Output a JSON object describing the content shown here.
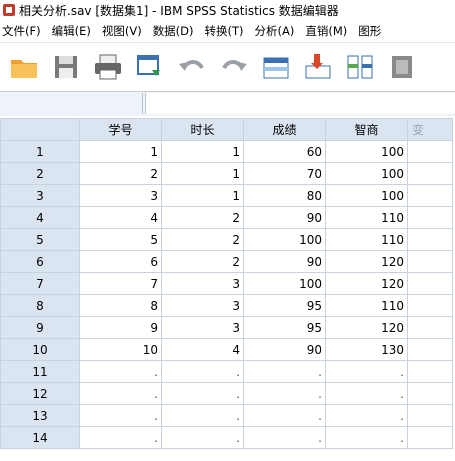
{
  "window": {
    "title": "相关分析.sav [数据集1] - IBM SPSS Statistics 数据编辑器"
  },
  "menu": [
    {
      "label": "文件(F)"
    },
    {
      "label": "编辑(E)"
    },
    {
      "label": "视图(V)"
    },
    {
      "label": "数据(D)"
    },
    {
      "label": "转换(T)"
    },
    {
      "label": "分析(A)"
    },
    {
      "label": "直销(M)"
    },
    {
      "label": "图形"
    }
  ],
  "toolbar": [
    {
      "icon": "open-folder-icon",
      "color": "#f0a030"
    },
    {
      "icon": "save-icon",
      "color": "#7a7a7a"
    },
    {
      "icon": "print-icon",
      "color": "#666666"
    },
    {
      "icon": "recall-dialog-icon",
      "color": "#3a6fb0"
    },
    {
      "icon": "undo-icon",
      "color": "#9aa0a6"
    },
    {
      "icon": "redo-icon",
      "color": "#9aa0a6"
    },
    {
      "icon": "goto-case-icon",
      "color": "#3a6fb0"
    },
    {
      "icon": "goto-variable-icon",
      "color": "#d9482b"
    },
    {
      "icon": "variables-icon",
      "color": "#3a6fb0"
    },
    {
      "icon": "find-icon",
      "color": "#8a8a8a"
    }
  ],
  "grid": {
    "columns": [
      "学号",
      "时长",
      "成绩",
      "智商",
      "变"
    ],
    "rows": [
      {
        "n": "1",
        "cells": [
          "1",
          "1",
          "60",
          "100"
        ]
      },
      {
        "n": "2",
        "cells": [
          "2",
          "1",
          "70",
          "100"
        ]
      },
      {
        "n": "3",
        "cells": [
          "3",
          "1",
          "80",
          "100"
        ]
      },
      {
        "n": "4",
        "cells": [
          "4",
          "2",
          "90",
          "110"
        ]
      },
      {
        "n": "5",
        "cells": [
          "5",
          "2",
          "100",
          "110"
        ]
      },
      {
        "n": "6",
        "cells": [
          "6",
          "2",
          "90",
          "120"
        ]
      },
      {
        "n": "7",
        "cells": [
          "7",
          "3",
          "100",
          "120"
        ]
      },
      {
        "n": "8",
        "cells": [
          "8",
          "3",
          "95",
          "110"
        ]
      },
      {
        "n": "9",
        "cells": [
          "9",
          "3",
          "95",
          "120"
        ]
      },
      {
        "n": "10",
        "cells": [
          "10",
          "4",
          "90",
          "130"
        ]
      },
      {
        "n": "11",
        "cells": [
          ".",
          ".",
          ".",
          "."
        ]
      },
      {
        "n": "12",
        "cells": [
          ".",
          ".",
          ".",
          "."
        ]
      },
      {
        "n": "13",
        "cells": [
          ".",
          ".",
          ".",
          "."
        ]
      },
      {
        "n": "14",
        "cells": [
          ".",
          ".",
          ".",
          "."
        ]
      }
    ]
  }
}
